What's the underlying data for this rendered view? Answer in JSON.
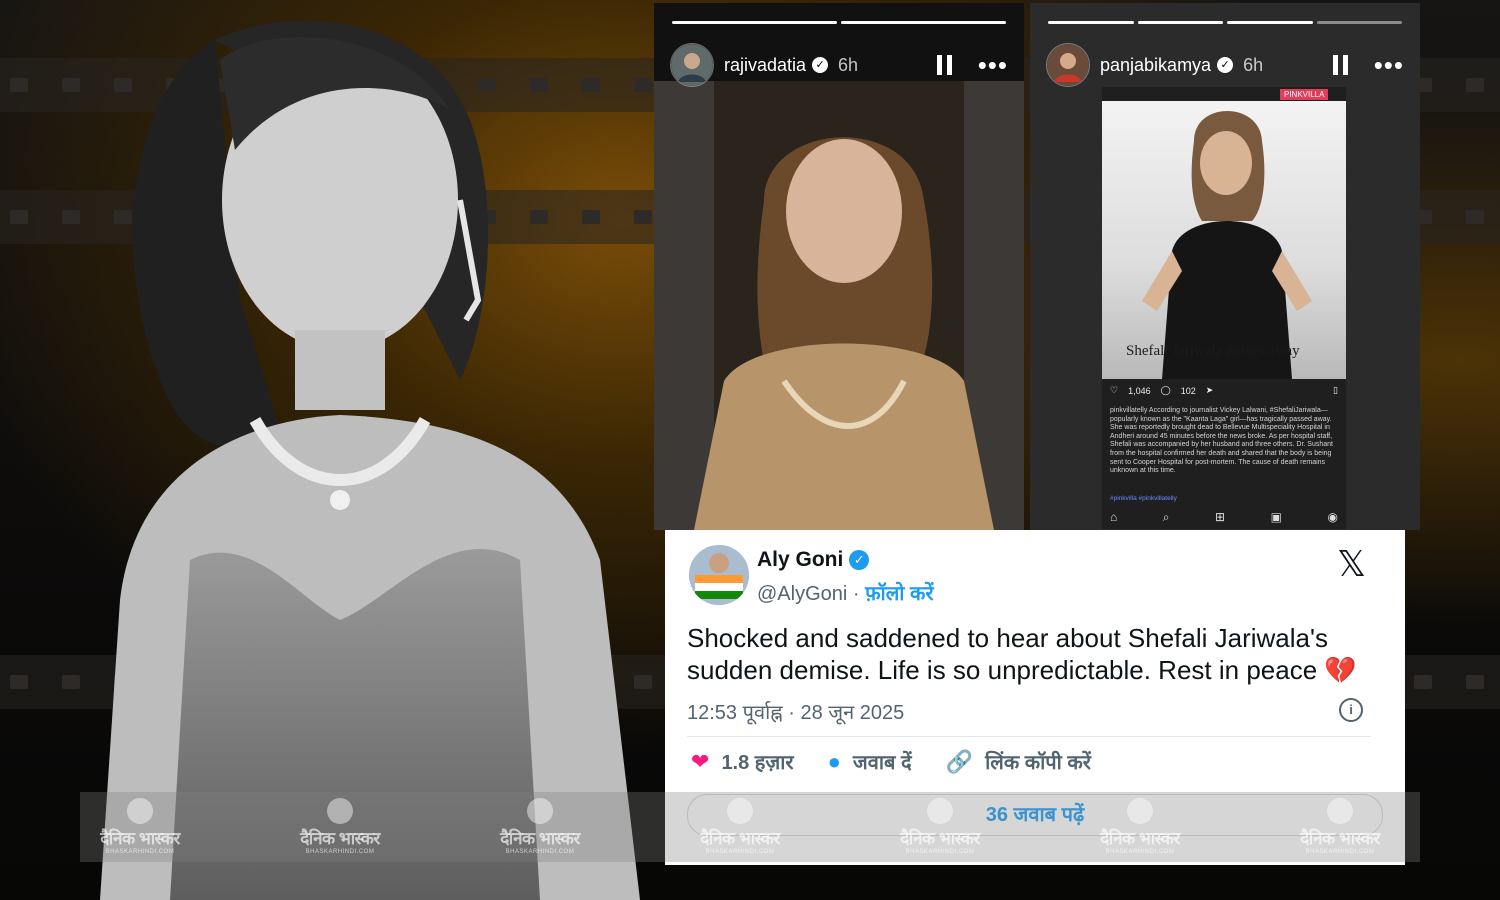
{
  "story_left": {
    "username": "rajivadatia",
    "time": "6h"
  },
  "story_right": {
    "username": "panjabikamya",
    "time": "6h",
    "post": {
      "brand": "PINKVILLA",
      "caption": "Shefali Jariwala passes away",
      "likes": "1,046",
      "comments": "102",
      "text": "pinkvillatelly According to journalist Vickey Lalwani, #ShefaliJariwala—popularly known as the \"Kaanta Laga\" girl—has tragically passed away. She was reportedly brought dead to Bellevue Multispeciality Hospital in Andheri around 45 minutes before the news broke. As per hospital staff, Shefali was accompanied by her husband and three others. Dr. Sushant from the hospital confirmed her death and shared that the body is being sent to Cooper Hospital for post-mortem. The cause of death remains unknown at this time.",
      "hashtags": "#pinkvilla #pinkvillatelly"
    }
  },
  "tweet": {
    "name": "Aly Goni",
    "handle": "@AlyGoni",
    "handle_sep": " · ",
    "follow": "फ़ॉलो करें",
    "text": "Shocked and saddened to hear about Shefali Jariwala's sudden demise. Life is so unpredictable. Rest in peace",
    "emoji": "💔",
    "timestamp": "12:53 पूर्वाह्न · 28 जून 2025",
    "likes": "1.8 हज़ार",
    "reply": "जवाब दें",
    "copy_link": "लिंक कॉपी करें",
    "read_replies": "36 जवाब पढ़ें"
  },
  "watermark": {
    "brand": "दैनिक भास्कर",
    "site": "BHASKARHINDI.COM"
  },
  "colors": {
    "twitter_blue": "#1d9bf0",
    "like_pink": "#f91880",
    "broken_heart": "#e0245e"
  }
}
